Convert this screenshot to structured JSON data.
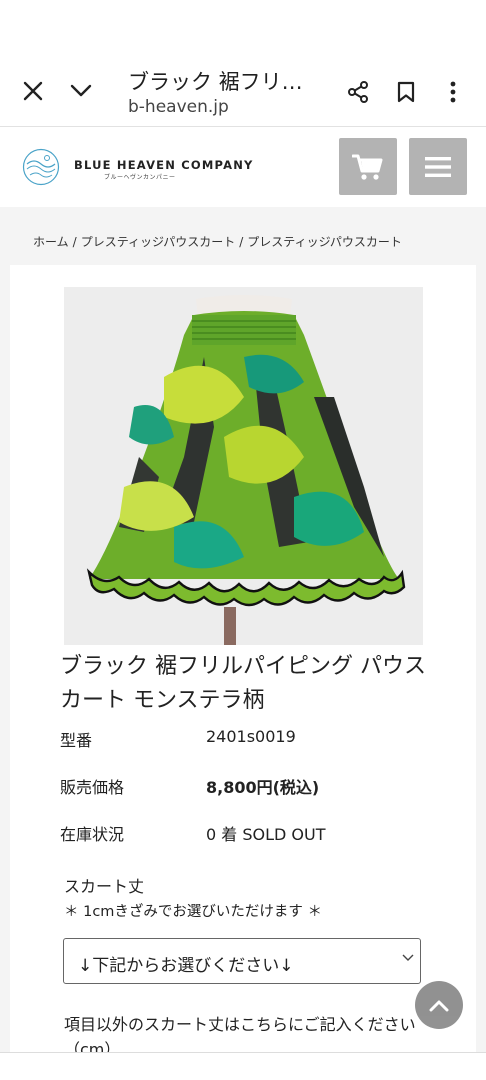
{
  "browser": {
    "title": "ブラック 裾フリ…",
    "url": "b-heaven.jp"
  },
  "site": {
    "logo_text": "BLUE HEAVEN COMPANY",
    "logo_sub": "ブルーヘヴンカンパニー"
  },
  "breadcrumb": [
    "ホーム",
    "プレスティッジパウスカート",
    "プレスティッジパウスカート"
  ],
  "breadcrumb_sep": "/",
  "product": {
    "title": "ブラック 裾フリルパイピング パウスカート モンステラ柄",
    "model_label": "型番",
    "model_value": "2401s0019",
    "price_label": "販売価格",
    "price_value": "8,800円(税込)",
    "stock_label": "在庫状況",
    "stock_value": "0 着 SOLD OUT"
  },
  "options": {
    "skirt_length_label": "スカート丈",
    "skirt_length_note": "＊ 1cmきざみでお選びいただけます ＊",
    "select_value": "↓下記からお選びください↓",
    "free_label": "項目以外のスカート丈はこちらにご記入ください（cm）"
  },
  "colors": {
    "header_button": "#b3b3b3",
    "scroll_button": "#8c8c8c",
    "page_bg": "#f4f4f4"
  }
}
